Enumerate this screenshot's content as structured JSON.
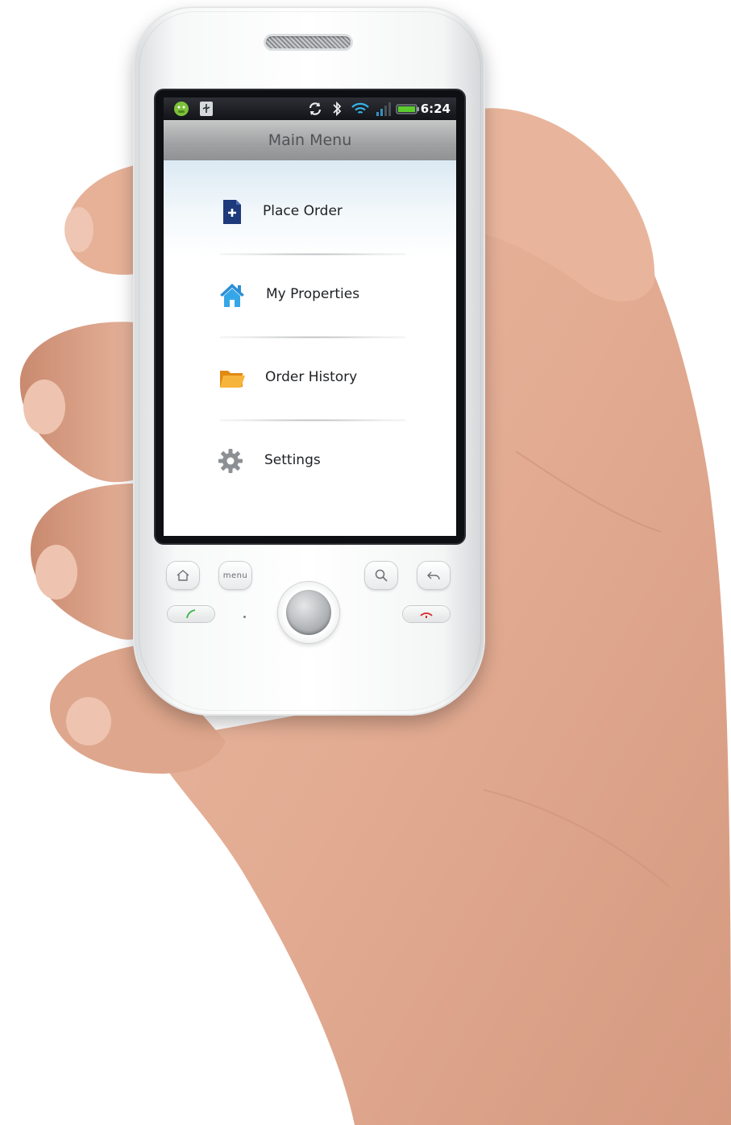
{
  "status_bar": {
    "time": "6:24",
    "icons": [
      "android-notification-icon",
      "usb-icon",
      "sync-icon",
      "bluetooth-icon",
      "wifi-icon",
      "signal-icon",
      "battery-icon"
    ]
  },
  "title_bar": {
    "title": "Main Menu"
  },
  "menu": {
    "items": [
      {
        "label": "Place Order",
        "icon": "new-document-icon"
      },
      {
        "label": "My Properties",
        "icon": "house-icon"
      },
      {
        "label": "Order History",
        "icon": "folder-icon"
      },
      {
        "label": "Settings",
        "icon": "gear-icon"
      }
    ]
  },
  "hardware_keys": {
    "menu_label": "menu",
    "items": [
      "home-icon",
      "menu-key",
      "search-icon",
      "back-icon",
      "call-icon",
      "end-call-icon"
    ]
  },
  "colors": {
    "status_bar": "#1a1c20",
    "title_bar": "#a7a9aa",
    "title_text": "#505355",
    "house_roof": "#2a8fd6",
    "house_body": "#35a7e8",
    "folder": "#f5a623",
    "document": "#1f3a7a",
    "gear": "#8c9094",
    "call_green": "#3bb54a",
    "end_red": "#d9262b"
  }
}
